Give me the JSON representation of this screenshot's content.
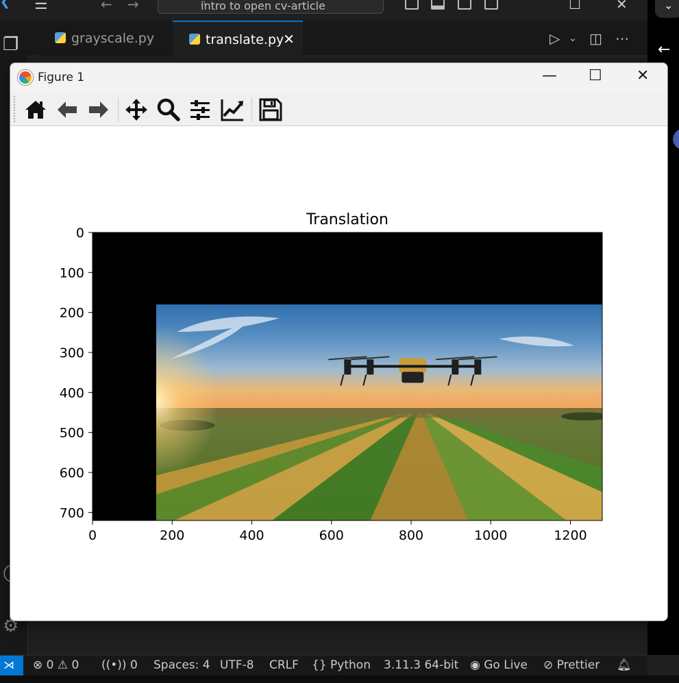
{
  "vscode": {
    "search_text": "intro to open cv-article",
    "tabs": [
      {
        "label": "grayscale.py",
        "active": false
      },
      {
        "label": "translate.py",
        "active": true
      }
    ],
    "tab_close_glyph": "✕"
  },
  "statusbar": {
    "errors": "0",
    "warnings": "0",
    "ports": "0",
    "spaces": "Spaces: 4",
    "encoding": "UTF-8",
    "eol": "CRLF",
    "language": "Python",
    "interpreter": "3.11.3 64-bit",
    "golive": "Go Live",
    "prettier": "Prettier"
  },
  "figure": {
    "window_title": "Figure 1",
    "toolbar_icons": [
      "home-icon",
      "back-arrow-icon",
      "forward-arrow-icon",
      "pan-icon",
      "zoom-icon",
      "subplots-config-icon",
      "edit-axis-icon",
      "save-icon"
    ]
  },
  "chart_data": {
    "type": "image",
    "title": "Translation",
    "xlabel": "",
    "ylabel": "",
    "xlim": [
      0,
      1280
    ],
    "ylim": [
      720,
      0
    ],
    "xticks": [
      0,
      200,
      400,
      600,
      800,
      1000,
      1200
    ],
    "yticks": [
      0,
      100,
      200,
      300,
      400,
      500,
      600,
      700
    ],
    "image_offset": {
      "x": 160,
      "y": 180
    },
    "image_content": "drone over farm fields at sunset",
    "background_color": "#000000",
    "grid": false
  }
}
